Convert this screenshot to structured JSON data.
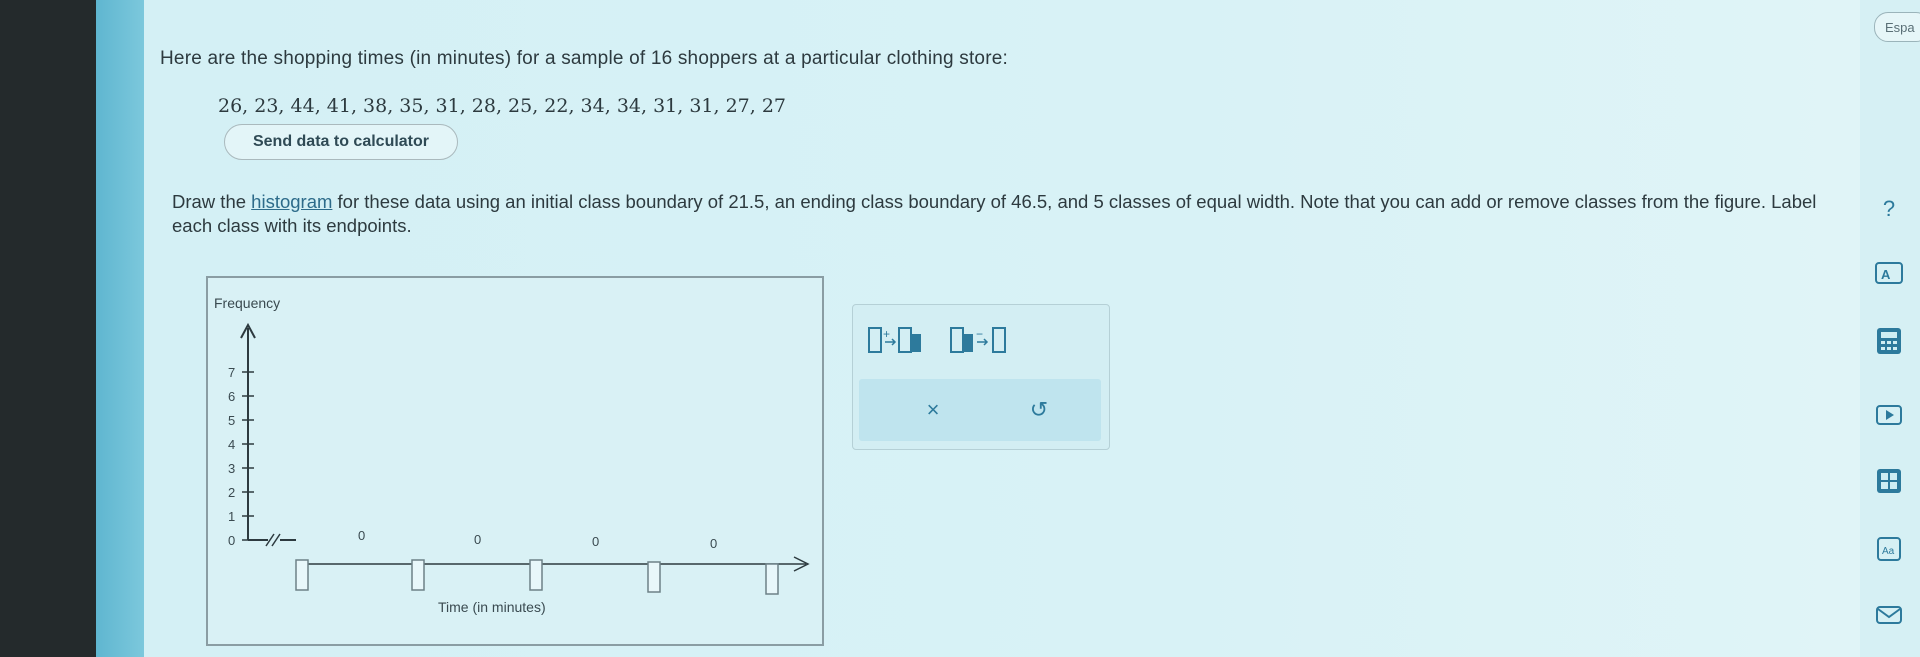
{
  "problem": {
    "intro": "Here are the shopping times (in minutes) for a sample of 16 shoppers at a particular clothing store:",
    "dataset": "26, 23, 44, 41, 38, 35, 31, 28, 25, 22, 34, 34, 31, 31, 27, 27",
    "send_button": "Send data to calculator",
    "instructions_pre": "Draw the ",
    "instructions_link": "histogram",
    "instructions_post": " for these data using an initial class boundary of 21.5, an ending class boundary of 46.5, and 5 classes of equal width. Note that you can add or remove classes from the figure. Label each class with its endpoints."
  },
  "graph": {
    "y_axis_label": "Frequency",
    "x_axis_label": "Time (in minutes)",
    "y_ticks": [
      "0",
      "1",
      "2",
      "3",
      "4",
      "5",
      "6",
      "7"
    ],
    "bar_values": [
      "0",
      "0",
      "0",
      "0"
    ],
    "boundary_inputs": [
      "",
      "",
      "",
      "",
      ""
    ]
  },
  "tools": {
    "add_class_icon": "add-class-icon",
    "remove_class_icon": "remove-class-icon",
    "clear": "×",
    "undo": "↺"
  },
  "sidebar": {
    "language": "Espa",
    "help": "?",
    "icons": [
      "audio-book-icon",
      "calculator-icon",
      "video-icon",
      "periodic-table-icon",
      "text-icon",
      "mail-icon"
    ]
  }
}
